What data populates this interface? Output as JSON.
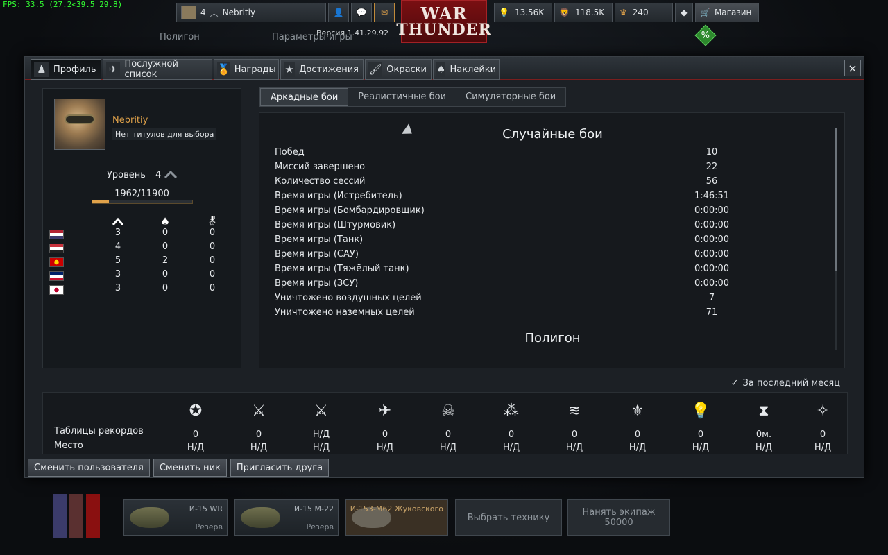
{
  "fps": "FPS: 33.5 (27.2<39.5 29.8)",
  "topbar": {
    "player_level": "4",
    "player_name": "Nebritiy",
    "golden_eagles": "13.56K",
    "silver_lions": "118.5K",
    "research_points": "240",
    "shop_label": "Магазин",
    "logo_line1": "WAR",
    "logo_line2": "THUNDER",
    "version": "Версия 1.41.29.92"
  },
  "bgmenu": {
    "polygon": "Полигон",
    "game_params": "Параметры игры"
  },
  "modal": {
    "tabs": [
      {
        "label": "Профиль"
      },
      {
        "label": "Послужной список"
      },
      {
        "label": "Награды"
      },
      {
        "label": "Достижения"
      },
      {
        "label": "Окраски"
      },
      {
        "label": "Наклейки"
      }
    ],
    "close_icon": "×"
  },
  "profile": {
    "nickname": "Nebritiy",
    "title": "Нет титулов для выбора",
    "level_label": "Уровень",
    "level_value": "4",
    "exp_text": "1962/11900",
    "exp_progress": 0.165,
    "nations": [
      {
        "flag": "usa",
        "colors": [
          "#b22234",
          "#ffffff",
          "#3c3b6e"
        ],
        "aircraft": "3",
        "tanks": "0",
        "medals": "0"
      },
      {
        "flag": "germany",
        "colors": [
          "#c8323c",
          "#ffffff",
          "#222222"
        ],
        "aircraft": "4",
        "tanks": "0",
        "medals": "0"
      },
      {
        "flag": "ussr",
        "colors": [
          "#cc0000",
          "#ffd700"
        ],
        "aircraft": "5",
        "tanks": "2",
        "medals": "0"
      },
      {
        "flag": "uk",
        "colors": [
          "#012169",
          "#ffffff",
          "#c8102e"
        ],
        "aircraft": "3",
        "tanks": "0",
        "medals": "0"
      },
      {
        "flag": "japan",
        "colors": [
          "#ffffff",
          "#bc002d"
        ],
        "aircraft": "3",
        "tanks": "0",
        "medals": "0"
      }
    ]
  },
  "mode_tabs": [
    {
      "label": "Аркадные бои",
      "active": true
    },
    {
      "label": "Реалистичные бои",
      "active": false
    },
    {
      "label": "Симуляторные бои",
      "active": false
    }
  ],
  "stats": {
    "section1_title": "Случайные бои",
    "rows": [
      {
        "label": "Побед",
        "value": "10"
      },
      {
        "label": "Миссий завершено",
        "value": "22"
      },
      {
        "label": "Количество сессий",
        "value": "56"
      },
      {
        "label": "Время игры (Истребитель)",
        "value": "1:46:51"
      },
      {
        "label": "Время игры (Бомбардировщик)",
        "value": "0:00:00"
      },
      {
        "label": "Время игры (Штурмовик)",
        "value": "0:00:00"
      },
      {
        "label": "Время игры (Танк)",
        "value": "0:00:00"
      },
      {
        "label": "Время игры (САУ)",
        "value": "0:00:00"
      },
      {
        "label": "Время игры (Тяжёлый танк)",
        "value": "0:00:00"
      },
      {
        "label": "Время игры (ЗСУ)",
        "value": "0:00:00"
      },
      {
        "label": "Уничтожено воздушных целей",
        "value": "7"
      },
      {
        "label": "Уничтожено наземных целей",
        "value": "71"
      }
    ],
    "section2_title": "Полигон"
  },
  "last_month_label": "За последний месяц",
  "leaderboard": {
    "records_label": "Таблицы рекордов",
    "place_label": "Место",
    "columns": [
      {
        "icon": "victories-icon",
        "value": "0",
        "place": "Н/Д"
      },
      {
        "icon": "battles-icon",
        "value": "0",
        "place": "Н/Д"
      },
      {
        "icon": "winrate-icon",
        "value": "Н/Д",
        "place": "Н/Д"
      },
      {
        "icon": "air-kills-icon",
        "value": "0",
        "place": "Н/Д"
      },
      {
        "icon": "ground-kills-icon",
        "value": "0",
        "place": "Н/Д"
      },
      {
        "icon": "rank-stars-icon",
        "value": "0",
        "place": "Н/Д"
      },
      {
        "icon": "chevrons-icon",
        "value": "0",
        "place": "Н/Д"
      },
      {
        "icon": "lions-icon",
        "value": "0",
        "place": "Н/Д"
      },
      {
        "icon": "eagles-icon",
        "value": "0",
        "place": "Н/Д"
      },
      {
        "icon": "time-icon",
        "value": "0м.",
        "place": "Н/Д"
      },
      {
        "icon": "score-icon",
        "value": "0",
        "place": "Н/Д"
      }
    ]
  },
  "actions": {
    "change_user": "Сменить пользователя",
    "change_nick": "Сменить ник",
    "invite_friend": "Пригласить друга"
  },
  "garage": {
    "slots": [
      {
        "name": "И-15 WR",
        "status": "Резерв"
      },
      {
        "name": "И-15 М-22",
        "status": "Резерв"
      },
      {
        "name": "И-153-М62 Жуковского",
        "status": ""
      }
    ],
    "select_vehicle": "Выбрать технику",
    "hire_crew": "Нанять экипаж",
    "hire_cost": "50000"
  }
}
